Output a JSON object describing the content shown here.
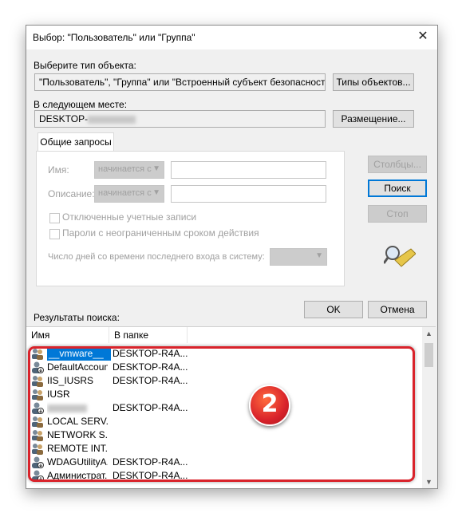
{
  "dialog": {
    "title": "Выбор: \"Пользователь\" или \"Группа\"",
    "close_glyph": "✕"
  },
  "object_type": {
    "label": "Выберите тип объекта:",
    "value": "\"Пользователь\", \"Группа\" или \"Встроенный субъект безопасности\"",
    "button": "Типы объектов..."
  },
  "location": {
    "label": "В следующем месте:",
    "value": "DESKTOP-",
    "button": "Размещение..."
  },
  "queries": {
    "tab": "Общие запросы",
    "name_label": "Имя:",
    "desc_label": "Описание:",
    "starts_with": "начинается с",
    "disabled_accounts": "Отключенные учетные записи",
    "non_expiring": "Пароли с неограниченным сроком действия",
    "days_label": "Число дней со времени последнего входа в систему:"
  },
  "buttons": {
    "columns": "Столбцы...",
    "search": "Поиск",
    "stop": "Стоп",
    "ok": "OK",
    "cancel": "Отмена"
  },
  "results": {
    "label": "Результаты поиска:",
    "columns": [
      "Имя",
      "В папке"
    ],
    "rows": [
      {
        "name": "__vmware__",
        "folder": "DESKTOP-R4A...",
        "icon": "group-icon"
      },
      {
        "name": "DefaultAccount",
        "folder": "DESKTOP-R4A...",
        "icon": "user-icon"
      },
      {
        "name": "IIS_IUSRS",
        "folder": "DESKTOP-R4A...",
        "icon": "group-icon"
      },
      {
        "name": "IUSR",
        "folder": "",
        "icon": "group-icon"
      },
      {
        "name": "",
        "folder": "DESKTOP-R4A...",
        "icon": "user-icon"
      },
      {
        "name": "LOCAL SERV...",
        "folder": "",
        "icon": "group-icon"
      },
      {
        "name": "NETWORK S...",
        "folder": "",
        "icon": "group-icon"
      },
      {
        "name": "REMOTE INT...",
        "folder": "",
        "icon": "group-icon"
      },
      {
        "name": "WDAGUtilityA...",
        "folder": "DESKTOP-R4A...",
        "icon": "user-icon"
      },
      {
        "name": "Администрат...",
        "folder": "DESKTOP-R4A...",
        "icon": "user-icon"
      }
    ]
  },
  "annotation": {
    "badge": "2",
    "color": "#d9232b"
  }
}
